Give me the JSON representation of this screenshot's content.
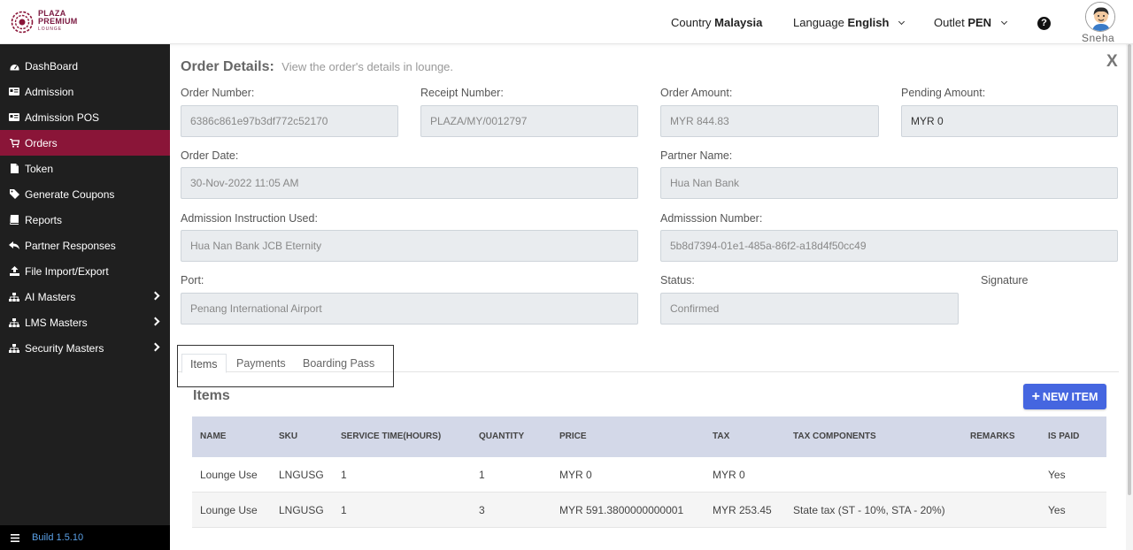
{
  "brand": {
    "line1": "PLAZA",
    "line2": "PREMIUM",
    "line3": "LOUNGE"
  },
  "header": {
    "country_label": "Country",
    "country_value": "Malaysia",
    "language_label": "Language",
    "language_value": "English",
    "outlet_label": "Outlet",
    "outlet_value": "PEN",
    "help_glyph": "?",
    "user_name": "Sneha"
  },
  "sidebar": {
    "items": [
      {
        "label": "DashBoard",
        "icon": "dashboard-icon"
      },
      {
        "label": "Admission",
        "icon": "id-card-icon"
      },
      {
        "label": "Admission POS",
        "icon": "id-card-icon"
      },
      {
        "label": "Orders",
        "icon": "cart-icon",
        "active": true
      },
      {
        "label": "Token",
        "icon": "file-icon"
      },
      {
        "label": "Generate Coupons",
        "icon": "tag-icon"
      },
      {
        "label": "Reports",
        "icon": "book-icon"
      },
      {
        "label": "Partner Responses",
        "icon": "reply-icon"
      },
      {
        "label": "File Import/Export",
        "icon": "upload-icon"
      },
      {
        "label": "AI Masters",
        "icon": "sitemap-icon",
        "expandable": true
      },
      {
        "label": "LMS Masters",
        "icon": "sitemap-icon",
        "expandable": true
      },
      {
        "label": "Security Masters",
        "icon": "sitemap-icon",
        "expandable": true
      }
    ],
    "build": "Build 1.5.10"
  },
  "order": {
    "title": "Order Details:",
    "subtitle": "View the order's details in lounge.",
    "close_glyph": "X",
    "order_number_label": "Order Number:",
    "order_number": "6386c861e97b3df772c52170",
    "receipt_number_label": "Receipt Number:",
    "receipt_number": "PLAZA/MY/0012797",
    "order_amount_label": "Order Amount:",
    "order_amount": "MYR 844.83",
    "pending_amount_label": "Pending Amount:",
    "pending_amount": "MYR 0",
    "order_date_label": "Order Date:",
    "order_date": "30-Nov-2022 11:05 AM",
    "partner_name_label": "Partner Name:",
    "partner_name": "Hua Nan Bank",
    "admission_instruction_label": "Admission Instruction Used:",
    "admission_instruction": "Hua Nan Bank JCB Eternity",
    "admission_number_label": "Admisssion Number:",
    "admission_number": "5b8d7394-01e1-485a-86f2-a18d4f50cc49",
    "port_label": "Port:",
    "port": "Penang International Airport",
    "status_label": "Status:",
    "status": "Confirmed",
    "signature_label": "Signature"
  },
  "tabs": [
    {
      "label": "Items",
      "active": true
    },
    {
      "label": "Payments"
    },
    {
      "label": "Boarding Pass"
    }
  ],
  "items": {
    "title": "Items",
    "new_button_plus": "+",
    "new_button": "NEW ITEM",
    "columns": [
      "NAME",
      "SKU",
      "SERVICE TIME(HOURS)",
      "QUANTITY",
      "PRICE",
      "TAX",
      "TAX COMPONENTS",
      "REMARKS",
      "IS PAID"
    ],
    "rows": [
      [
        "Lounge Use",
        "LNGUSG",
        "1",
        "1",
        "MYR 0",
        "MYR 0",
        "",
        "",
        "Yes"
      ],
      [
        "Lounge Use",
        "LNGUSG",
        "1",
        "3",
        "MYR 591.3800000000001",
        "MYR 253.45",
        "State tax (ST - 10%, STA - 20%)",
        "",
        "Yes"
      ]
    ]
  }
}
